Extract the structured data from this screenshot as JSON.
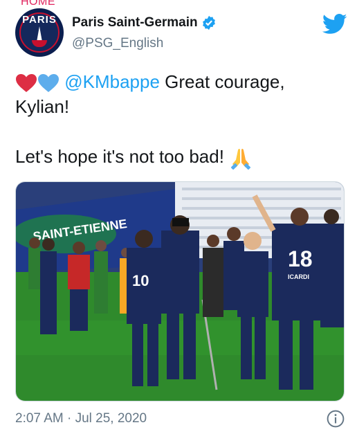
{
  "page": {
    "cropped_label": "HOME"
  },
  "author": {
    "display_name": "Paris Saint-Germain",
    "handle": "@PSG_English",
    "avatar_text": "PARIS",
    "verified_icon": "verified-badge-icon"
  },
  "tweet": {
    "emojis": [
      "red-heart-icon",
      "blue-heart-icon"
    ],
    "mention": "@KMbappe",
    "line1_rest": " Great courage,",
    "line2": "Kylian!",
    "line3": "Let's hope it's not too bad!",
    "end_emoji": "folded-hands-icon"
  },
  "media": {
    "jersey_numbers": [
      "18",
      "10"
    ],
    "jersey_name": "ICARDI",
    "description_colors": {
      "pitch": "#2f8a2c",
      "kit": "#1b2a5c",
      "stand": "#1d3a8a"
    }
  },
  "footer": {
    "timestamp": "2:07 AM · Jul 25, 2020"
  },
  "colors": {
    "accent": "#1da1f2",
    "muted": "#657786",
    "heart_red": "#e0245e",
    "heart_blue": "#5dadec"
  }
}
